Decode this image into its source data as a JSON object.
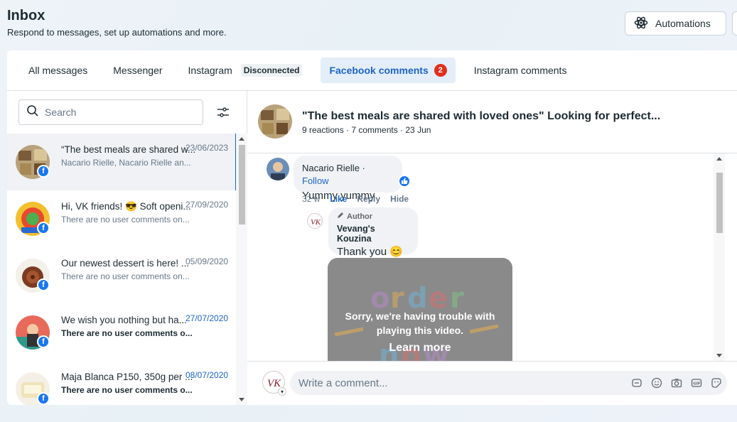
{
  "header": {
    "title": "Inbox",
    "subtitle": "Respond to messages, set up automations and more.",
    "automations_label": "Automations"
  },
  "tabs": [
    {
      "label": "All messages"
    },
    {
      "label": "Messenger"
    },
    {
      "label": "Instagram",
      "tag": "Disconnected"
    },
    {
      "label": "Facebook comments",
      "badge": "2",
      "active": true
    },
    {
      "label": "Instagram comments"
    }
  ],
  "search": {
    "placeholder": "Search"
  },
  "conversations": [
    {
      "title": "“The best meals are shared w...",
      "subtitle": "Nacario Rielle, Nacario Rielle an...",
      "date": "23/06/2023",
      "selected": true,
      "unread": false
    },
    {
      "title": "Hi, VK friends! 😎 Soft openi...",
      "subtitle": "There are no user comments on...",
      "date": "27/09/2020",
      "unread": false
    },
    {
      "title": "Our newest dessert is here! ...",
      "subtitle": "There are no user comments on...",
      "date": "05/09/2020",
      "unread": false
    },
    {
      "title": "We wish you nothing but ha...",
      "subtitle": "There are no user comments o...",
      "date": "27/07/2020",
      "unread": true
    },
    {
      "title": "Maja Blanca P150, 350g per ...",
      "subtitle": "There are no user comments o...",
      "date": "08/07/2020",
      "unread": true
    }
  ],
  "post": {
    "title": "\"The best meals are shared with loved ones\" Looking for perfect...",
    "meta": "9 reactions · 7 comments · 23 Jun"
  },
  "comment": {
    "author": "Nacario Rielle",
    "separator": " · ",
    "follow": "Follow",
    "text": "Yummy yummy",
    "age": "32 w",
    "like": "Like",
    "reply": "Reply",
    "hide": "Hide"
  },
  "reply": {
    "author_tag": "Author",
    "name": "Vevang's Kouzina",
    "text": "Thank you 😊"
  },
  "video": {
    "message": "Sorry, we're having trouble with playing this video.",
    "learn_more": "Learn more"
  },
  "composer": {
    "placeholder": "Write a comment..."
  },
  "colors": {
    "accent": "#1d63c4",
    "badge": "#e0301e",
    "facebook": "#1877f2"
  }
}
